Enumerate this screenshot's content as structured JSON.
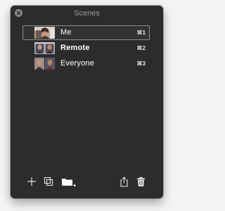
{
  "window": {
    "title": "Scenes"
  },
  "scenes": [
    {
      "name": "Me",
      "shortcut": "⌘1",
      "selected": true
    },
    {
      "name": "Remote",
      "shortcut": "⌘2",
      "selected": false
    },
    {
      "name": "Everyone",
      "shortcut": "⌘3",
      "selected": false
    }
  ],
  "toolbar": {
    "add_icon": "plus-icon",
    "duplicate_icon": "duplicate-icon",
    "new_folder_icon": "new-folder-icon",
    "share_icon": "share-icon",
    "delete_icon": "trash-icon"
  },
  "colors": {
    "panel_background": "#2c2c2c",
    "text": "#ffffff",
    "title_text": "#9a9a9a",
    "selection_border": "#8c8c8c"
  }
}
